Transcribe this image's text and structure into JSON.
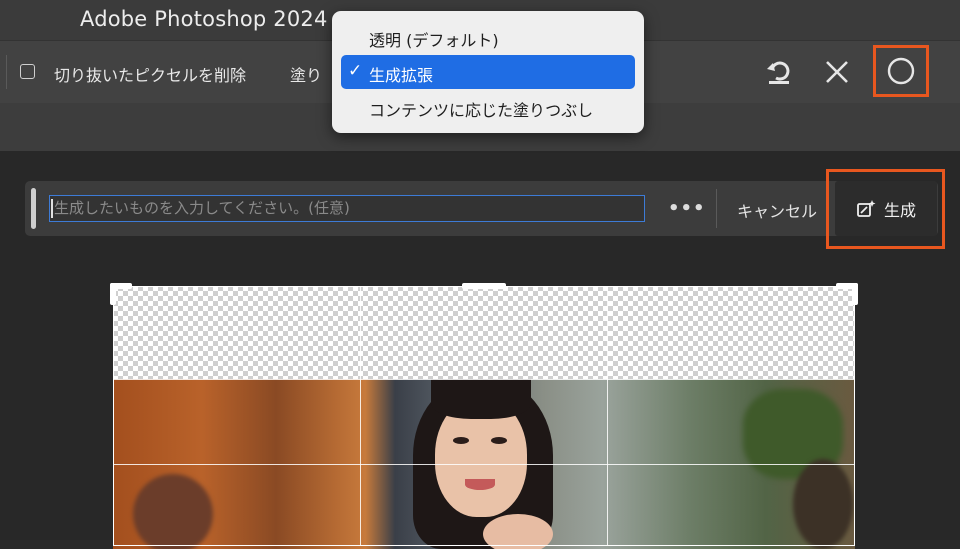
{
  "app": {
    "title": "Adobe Photoshop 2024"
  },
  "options_bar": {
    "delete_cropped_label": "切り抜いたピクセルを削除",
    "fill_label": "塗り",
    "reset_icon": "rotate-reset-icon",
    "cancel_icon": "close-icon",
    "commit_icon": "circle-commit-icon"
  },
  "fill_dropdown": {
    "options": [
      "透明 (デフォルト)",
      "生成拡張",
      "コンテンツに応じた塗りつぶし"
    ],
    "selected": "生成拡張",
    "selected_color": "#1f6de4"
  },
  "task_bar": {
    "prompt_placeholder": "生成したいものを入力してください。(任意)",
    "prompt_value": "",
    "more_label": "•••",
    "cancel_label": "キャンセル",
    "generate_label": "生成",
    "generate_icon": "generate-sparkle-icon",
    "highlight_color": "#e8571f"
  }
}
